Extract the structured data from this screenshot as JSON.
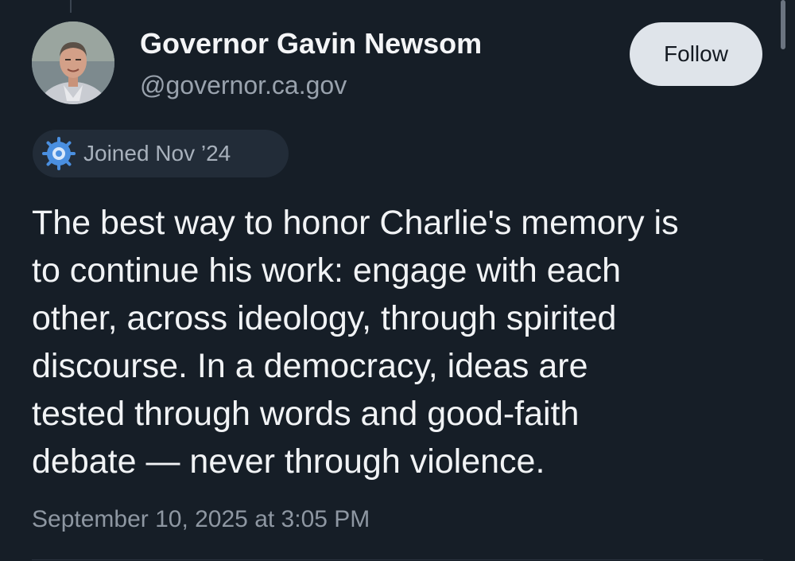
{
  "profile": {
    "display_name": "Governor Gavin Newsom",
    "handle": "@governor.ca.gov",
    "avatar_icon": "profile-photo"
  },
  "actions": {
    "follow_label": "Follow"
  },
  "badge": {
    "icon": "gear-badge-icon",
    "label": "Joined Nov ’24"
  },
  "post": {
    "text": "The best way to honor Charlie's memory is\nto continue his work: engage with each\nother, across ideology, through spirited\ndiscourse. In a democracy, ideas are\ntested through words and good-faith\ndebate — never through violence.",
    "timestamp": "September 10, 2025 at 3:05 PM"
  },
  "colors": {
    "background": "#161e27",
    "follow_button_bg": "#dfe4ea",
    "badge_bg": "#222c38",
    "badge_icon": "#4a8fe0",
    "muted_text": "#99a2ad"
  }
}
